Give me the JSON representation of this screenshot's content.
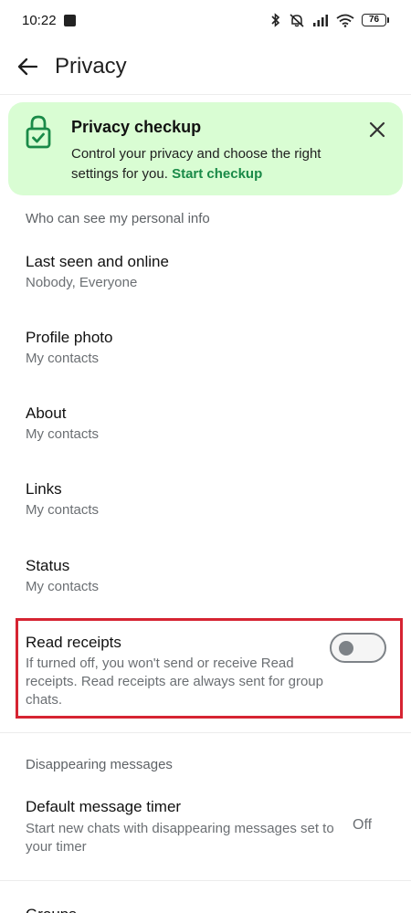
{
  "status_bar": {
    "time": "10:22",
    "battery": "76",
    "icons": [
      "bluetooth-icon",
      "mute-icon",
      "signal-icon",
      "wifi-icon",
      "battery-icon"
    ]
  },
  "app_bar": {
    "title": "Privacy",
    "back_icon": "arrow-left-icon"
  },
  "checkup": {
    "title": "Privacy checkup",
    "description": "Control your privacy and choose the right settings for you.",
    "link": "Start checkup",
    "accent": "#1a8a48",
    "background": "#d9fdd3"
  },
  "personal_info": {
    "header": "Who can see my personal info",
    "items": [
      {
        "title": "Last seen and online",
        "value": "Nobody, Everyone"
      },
      {
        "title": "Profile photo",
        "value": "My contacts"
      },
      {
        "title": "About",
        "value": "My contacts"
      },
      {
        "title": "Links",
        "value": "My contacts"
      },
      {
        "title": "Status",
        "value": "My contacts"
      }
    ]
  },
  "read_receipts": {
    "title": "Read receipts",
    "description": "If turned off, you won't send or receive Read receipts. Read receipts are always sent for group chats.",
    "enabled": false,
    "highlight_color": "#d62432"
  },
  "disappearing": {
    "header": "Disappearing messages",
    "timer_title": "Default message timer",
    "timer_desc": "Start new chats with disappearing messages set to your timer",
    "timer_value": "Off"
  },
  "next_item": {
    "title": "Groups"
  }
}
